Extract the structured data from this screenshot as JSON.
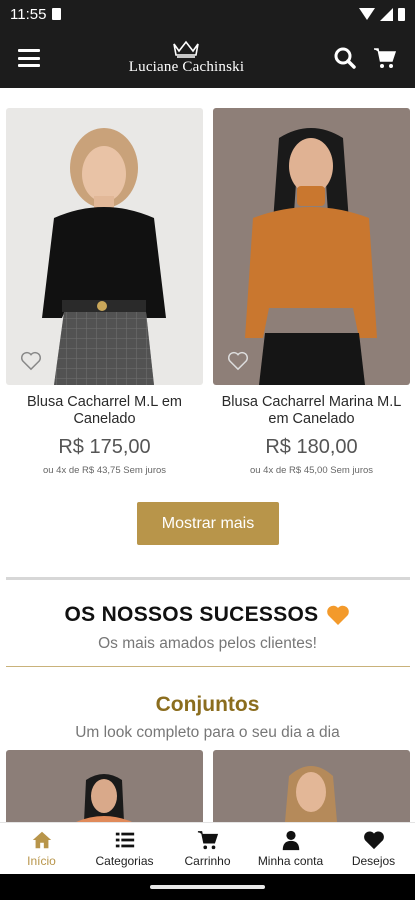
{
  "status_bar": {
    "time": "11:55",
    "icons": [
      "sim-icon",
      "wifi-icon",
      "signal-icon",
      "battery-icon"
    ]
  },
  "header": {
    "brand_name": "Luciane Cachinski",
    "icons": [
      "menu-icon",
      "crown-logo",
      "search-icon",
      "cart-icon"
    ]
  },
  "products": [
    {
      "name": "Blusa Cacharrel M.L em Canelado",
      "price": "R$ 175,00",
      "installments": "ou 4x de R$ 43,75 Sem juros"
    },
    {
      "name": "Blusa Cacharrel Marina M.L em Canelado",
      "price": "R$ 180,00",
      "installments": "ou 4x de R$ 45,00 Sem juros"
    }
  ],
  "show_more_label": "Mostrar mais",
  "success_section": {
    "title": "OS NOSSOS SUCESSOS",
    "subtitle": "Os mais amados pelos clientes!"
  },
  "sets_section": {
    "title": "Conjuntos",
    "subtitle": "Um look completo para o seu dia a dia"
  },
  "bottom_nav": [
    {
      "label": "Início",
      "icon": "home-icon",
      "active": true
    },
    {
      "label": "Categorias",
      "icon": "list-icon",
      "active": false
    },
    {
      "label": "Carrinho",
      "icon": "cart-icon",
      "active": false
    },
    {
      "label": "Minha conta",
      "icon": "user-icon",
      "active": false
    },
    {
      "label": "Desejos",
      "icon": "heart-icon",
      "active": false
    }
  ],
  "colors": {
    "header_bg": "#1c1c1c",
    "accent_gold": "#b8954a",
    "sets_title": "#8b6d1e",
    "heart_orange": "#f39a2b"
  }
}
